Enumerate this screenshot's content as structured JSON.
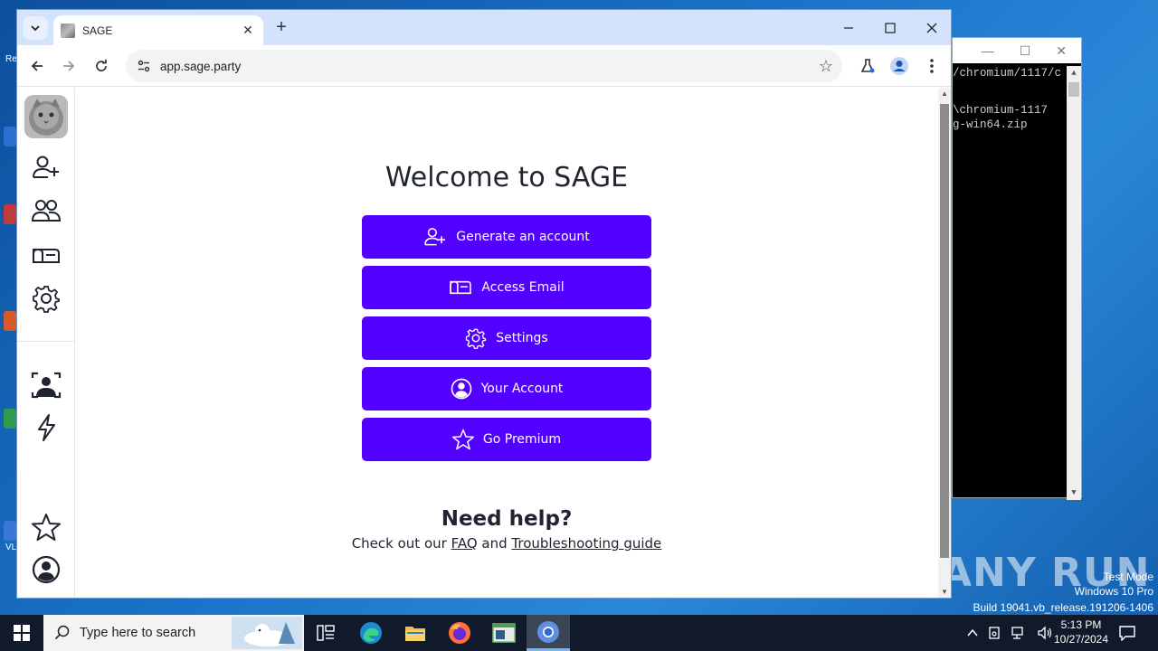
{
  "desktop": {
    "watermark": "ANY RUN",
    "system_info": [
      "Test Mode",
      "Windows 10 Pro",
      "Build 19041.vb_release.191206-1406"
    ],
    "icon_labels": [
      "Re",
      "VL"
    ]
  },
  "terminal": {
    "lines": [
      "/chromium/1117/c",
      "",
      "",
      "\\chromium-1117",
      "g-win64.zip"
    ]
  },
  "browser": {
    "tab_title": "SAGE",
    "url": "app.sage.party"
  },
  "page": {
    "welcome": "Welcome to SAGE",
    "buttons": [
      {
        "label": "Generate an account",
        "icon": "person-add-icon"
      },
      {
        "label": "Access Email",
        "icon": "mailbox-icon"
      },
      {
        "label": "Settings",
        "icon": "gear-icon"
      },
      {
        "label": "Your Account",
        "icon": "person-circle-icon"
      },
      {
        "label": "Go Premium",
        "icon": "star-icon"
      }
    ],
    "help_title": "Need help?",
    "help_prefix": "Check out our ",
    "help_faq": "FAQ",
    "help_and": " and ",
    "help_guide": "Troubleshooting guide"
  },
  "sidebar": {
    "items": [
      "avatar",
      "person-add-icon",
      "people-icon",
      "mailbox-icon",
      "gear-icon",
      "person-badge-icon",
      "lightning-icon",
      "star-icon",
      "person-circle-icon"
    ]
  },
  "taskbar": {
    "search_placeholder": "Type here to search",
    "time": "5:13 PM",
    "date": "10/27/2024"
  },
  "colors": {
    "accent": "#5200ff",
    "tabbar": "#d3e3fd"
  }
}
